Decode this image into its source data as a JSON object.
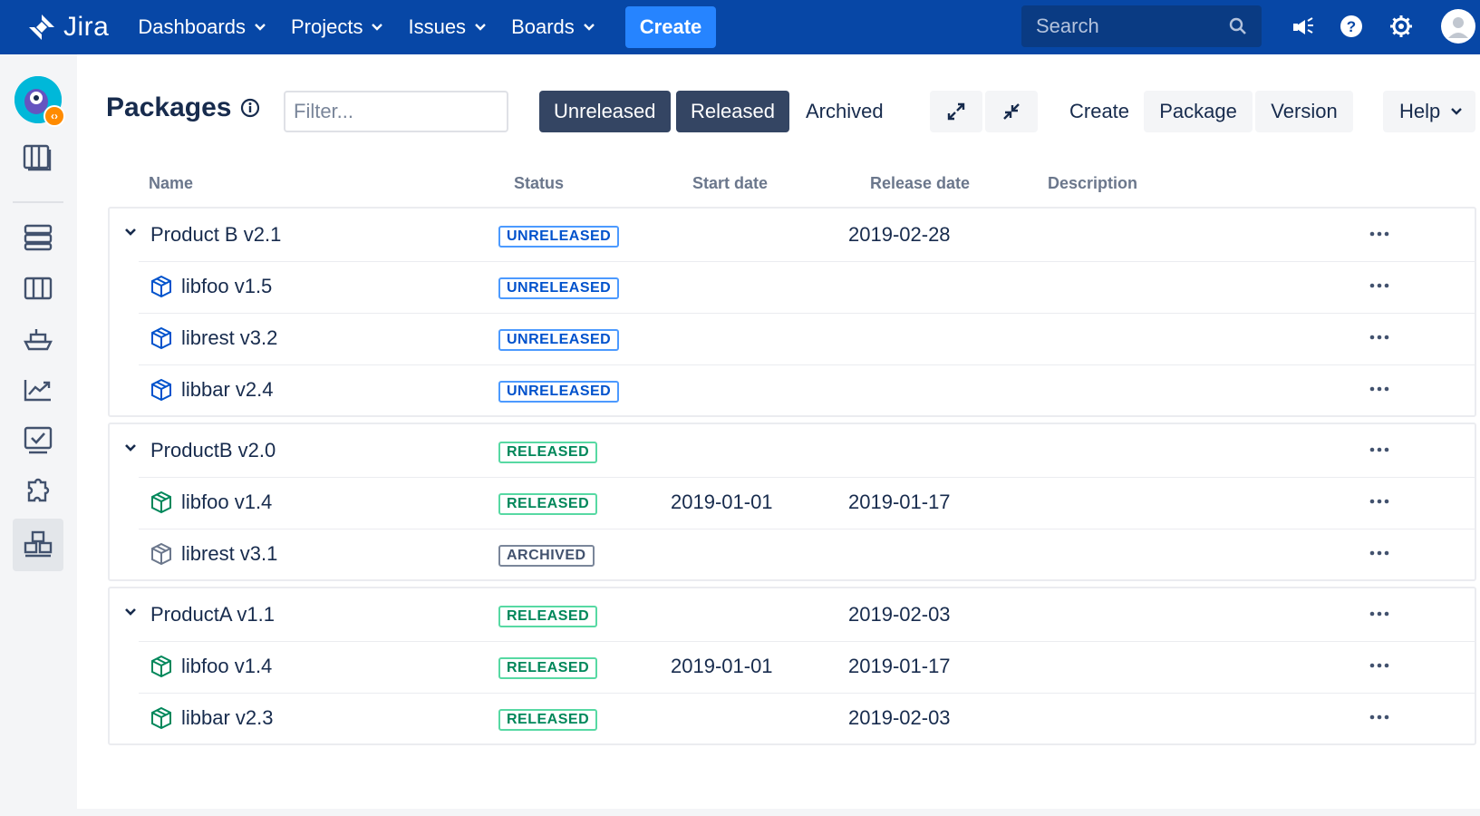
{
  "topnav": {
    "logo_text": "Jira",
    "items": [
      {
        "label": "Dashboards"
      },
      {
        "label": "Projects"
      },
      {
        "label": "Issues"
      },
      {
        "label": "Boards"
      }
    ],
    "create_label": "Create",
    "search_placeholder": "Search",
    "icons": [
      "notifications-icon",
      "help-icon",
      "settings-icon",
      "profile-avatar"
    ]
  },
  "sidebar": {
    "icons": [
      "project-avatar",
      "board-icon",
      "backlog-icon",
      "columns-icon",
      "releases-icon",
      "reports-icon",
      "issues-icon",
      "addons-icon",
      "packages-icon"
    ],
    "active": "packages-icon"
  },
  "page": {
    "title": "Packages",
    "filter_placeholder": "Filter...",
    "tabs": [
      {
        "label": "Unreleased",
        "selected": true
      },
      {
        "label": "Released",
        "selected": true
      },
      {
        "label": "Archived",
        "selected": false
      }
    ],
    "create_label": "Create",
    "package_label": "Package",
    "version_label": "Version",
    "help_label": "Help"
  },
  "table": {
    "columns": [
      "Name",
      "Status",
      "Start date",
      "Release date",
      "Description"
    ],
    "groups": [
      {
        "name": "Product B v2.1",
        "status": "UNRELEASED",
        "start": "",
        "release": "2019-02-28",
        "children": [
          {
            "name": "libfoo v1.5",
            "status": "UNRELEASED",
            "start": "",
            "release": ""
          },
          {
            "name": "librest v3.2",
            "status": "UNRELEASED",
            "start": "",
            "release": ""
          },
          {
            "name": "libbar v2.4",
            "status": "UNRELEASED",
            "start": "",
            "release": ""
          }
        ]
      },
      {
        "name": "ProductB v2.0",
        "status": "RELEASED",
        "start": "",
        "release": "",
        "children": [
          {
            "name": "libfoo v1.4",
            "status": "RELEASED",
            "start": "2019-01-01",
            "release": "2019-01-17"
          },
          {
            "name": "librest v3.1",
            "status": "ARCHIVED",
            "start": "",
            "release": ""
          }
        ]
      },
      {
        "name": "ProductA v1.1",
        "status": "RELEASED",
        "start": "",
        "release": "2019-02-03",
        "children": [
          {
            "name": "libfoo v1.4",
            "status": "RELEASED",
            "start": "2019-01-01",
            "release": "2019-01-17"
          },
          {
            "name": "libbar v2.3",
            "status": "RELEASED",
            "start": "",
            "release": "2019-02-03"
          }
        ]
      }
    ]
  },
  "colors": {
    "nav_bg": "#0747a6",
    "create_bg": "#2684ff",
    "unreleased": "#0052cc",
    "released": "#00875a",
    "archived": "#42526e"
  }
}
